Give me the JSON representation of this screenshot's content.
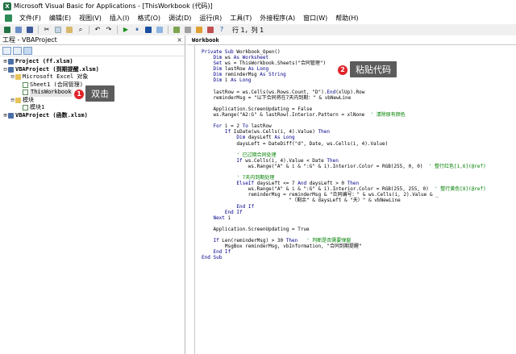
{
  "window": {
    "title": "Microsoft Visual Basic for Applications - [ThisWorkbook (代码)]",
    "app_icon_glyph": "X"
  },
  "menubar": {
    "items": [
      "文件(F)",
      "编辑(E)",
      "视图(V)",
      "插入(I)",
      "格式(O)",
      "调试(D)",
      "运行(R)",
      "工具(T)",
      "外接程序(A)",
      "窗口(W)",
      "帮助(H)"
    ]
  },
  "toolbar": {
    "position_label": "行 1，列 1"
  },
  "project_pane": {
    "title": "工程 - VBAProject",
    "close_glyph": "×",
    "tree": [
      {
        "indent": 0,
        "exp": "⊞",
        "icon": "vba",
        "label": "Project (ff.xlsm)",
        "bold": true
      },
      {
        "indent": 0,
        "exp": "⊟",
        "icon": "vba",
        "label": "VBAProject (到期提醒.xlsm)",
        "bold": true
      },
      {
        "indent": 1,
        "exp": "⊟",
        "icon": "folder",
        "label": "Microsoft Excel 对象",
        "bold": false
      },
      {
        "indent": 2,
        "exp": "",
        "icon": "sheet",
        "label": "Sheet1 (合同管理)",
        "bold": false
      },
      {
        "indent": 2,
        "exp": "",
        "icon": "sheet",
        "label": "ThisWorkbook",
        "bold": false,
        "selected": true
      },
      {
        "indent": 1,
        "exp": "⊟",
        "icon": "folder",
        "label": "模块",
        "bold": false
      },
      {
        "indent": 2,
        "exp": "",
        "icon": "sheet",
        "label": "模块1",
        "bold": false
      },
      {
        "indent": 0,
        "exp": "⊞",
        "icon": "vba",
        "label": "VBAProject (函数.xlsm)",
        "bold": true
      }
    ]
  },
  "annotations": {
    "step1": {
      "number": "1",
      "text": "双击"
    },
    "step2": {
      "number": "2",
      "text": "粘贴代码"
    }
  },
  "code_window": {
    "title": "Workbook",
    "lines": [
      "Private Sub Workbook_Open()",
      "    Dim ws As Worksheet",
      "    Set ws = ThisWorkbook.Sheets(\"合同管理\")",
      "    Dim lastRow As Long",
      "    Dim reminderMsg As String",
      "    Dim i As Long",
      "",
      "    lastRow = ws.Cells(ws.Rows.Count, \"D\").End(xlUp).Row",
      "    reminderMsg = \"以下合同将在7天内到期：\" & vbNewLine",
      "",
      "    Application.ScreenUpdating = False",
      "    ws.Range(\"A2:G\" & lastRow).Interior.Pattern = xlNone  ' 清除原有颜色",
      "",
      "    For i = 2 To lastRow",
      "        If IsDate(ws.Cells(i, 4).Value) Then",
      "            Dim daysLeft As Long",
      "            daysLeft = DateDiff(\"d\", Date, ws.Cells(i, 4).Value)",
      "",
      "            ' 已过期合同处理",
      "            If ws.Cells(i, 4).Value < Date Then",
      "                ws.Range(\"A\" & i & \":G\" & i).Interior.Color = RGB(255, 0, 0)  ' 整行红色[1,6](@ref)",
      "",
      "            ' 7天内到期处理",
      "            ElseIf daysLeft <= 7 And daysLeft > 0 Then",
      "                ws.Range(\"A\" & i & \":G\" & i).Interior.Color = RGB(255, 255, 0)  ' 整行黄色[8](@ref)",
      "                reminderMsg = reminderMsg & \"合同编号：\" & ws.Cells(i, 2).Value & _",
      "                              \"（剩余\" & daysLeft & \"天）\" & vbNewLine",
      "            End If",
      "        End If",
      "    Next i",
      "",
      "    Application.ScreenUpdating = True",
      "",
      "    If Len(reminderMsg) > 30 Then   ' 判断是否需要弹窗",
      "        MsgBox reminderMsg, vbInformation, \"合同到期提醒\"",
      "    End If",
      "End Sub"
    ]
  },
  "colors": {
    "keyword": "#00008b",
    "comment": "#008000",
    "callout_dot": "#e0242a",
    "callout_box": "#5c5c5c"
  }
}
